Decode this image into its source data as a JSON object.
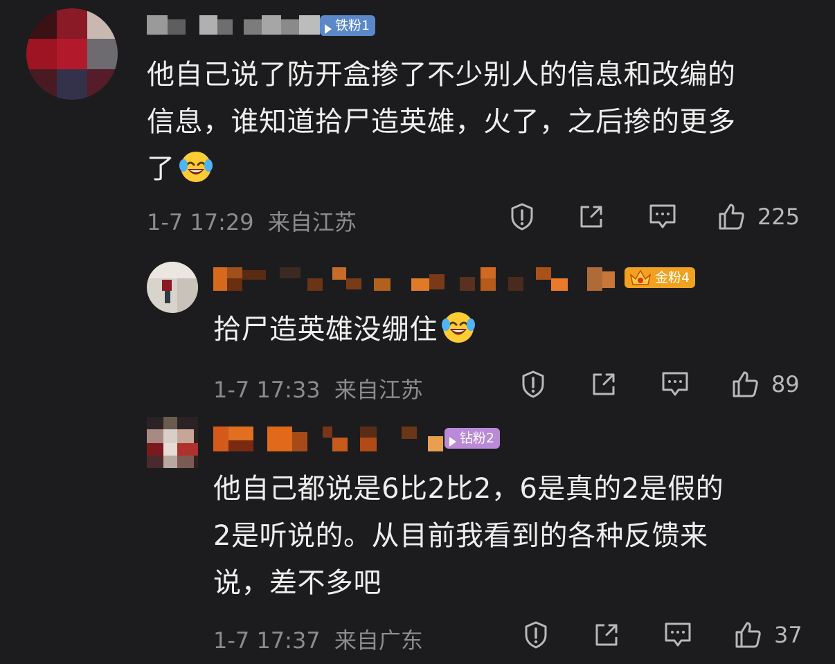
{
  "comments": [
    {
      "badge": "铁粉1",
      "text_lines": [
        "他自己说了防开盒掺了不少别人的信息和改编的",
        "信息，谁知道拾尸造英雄，火了，之后掺的更多",
        "了"
      ],
      "emoji": "laughing-tears-emoji",
      "time": "1-7 17:29",
      "location": "来自江苏",
      "likes": "225"
    },
    {
      "badge": "金粉4",
      "text_lines": [
        "拾尸造英雄没绷住"
      ],
      "emoji": "laughing-tears-emoji",
      "time": "1-7 17:33",
      "location": "来自江苏",
      "likes": "89"
    },
    {
      "badge": "钻粉2",
      "text_lines": [
        "他自己都说是6比2比2，6是真的2是假的",
        "2是听说的。从目前我看到的各种反馈来",
        "说，差不多吧"
      ],
      "time": "1-7 17:37",
      "location": "来自广东",
      "likes": "37"
    }
  ],
  "icons": {
    "report": "report-shield-icon",
    "share": "share-icon",
    "reply": "reply-comment-icon",
    "like": "thumbs-up-icon"
  },
  "colors": {
    "background": "#1c1c1e",
    "text": "#eeeeee",
    "meta": "#8c8c8e",
    "badge_iron": "#5b88c9",
    "badge_gold": "#f0a11f",
    "badge_diamond": "#b98ad8"
  }
}
